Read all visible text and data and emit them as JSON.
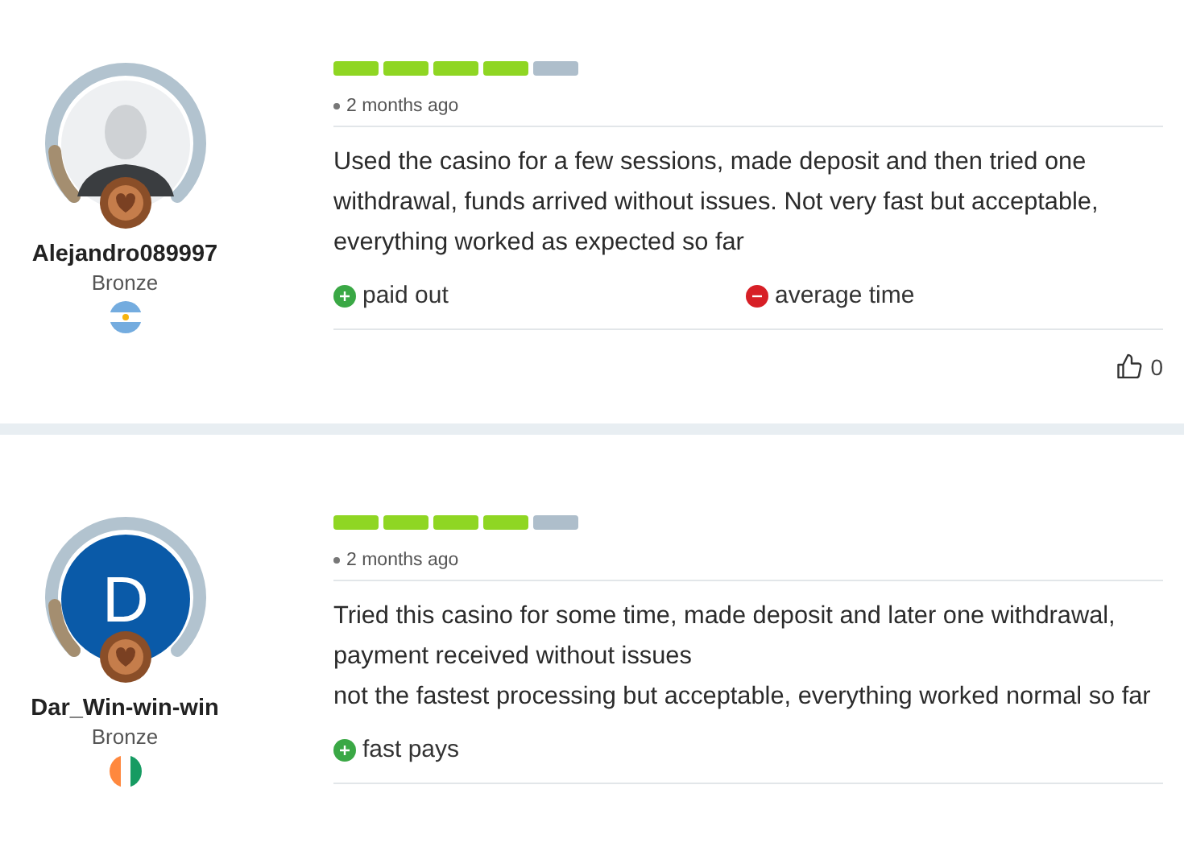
{
  "reviews": [
    {
      "user": {
        "name": "Alejandro089997",
        "rank": "Bronze",
        "avatar": {
          "kind": "silhouette"
        }
      },
      "stars": 4,
      "time": "2 months ago",
      "text": "Used the casino for a few sessions, made deposit and then tried one withdrawal, funds arrived without issues. Not very fast but acceptable, everything worked as expected so far",
      "tags": [
        {
          "kind": "plus",
          "label": "paid out"
        },
        {
          "kind": "minus",
          "label": "average time"
        }
      ],
      "likes": "0"
    },
    {
      "user": {
        "name": "Dar_Win-win-win",
        "rank": "Bronze",
        "avatar": {
          "kind": "letter",
          "letter": "D"
        }
      },
      "stars": 4,
      "time": "2 months ago",
      "text": "Tried this casino for some time, made deposit and later one withdrawal, payment received without issues\nnot the fastest processing but acceptable, everything worked normal so far",
      "tags": [
        {
          "kind": "plus",
          "label": "fast pays"
        }
      ]
    }
  ]
}
